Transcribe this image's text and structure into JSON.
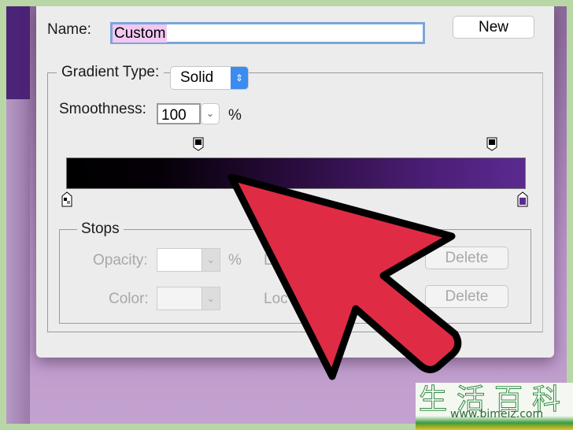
{
  "dialog": {
    "name_label": "Name:",
    "name_value": "Custom",
    "new_button": "New",
    "gradient_type_label": "Gradient Type:",
    "gradient_type_value": "Solid",
    "smoothness_label": "Smoothness:",
    "smoothness_value": "100",
    "smoothness_unit": "%",
    "stops": {
      "title": "Stops",
      "opacity_label": "Opacity:",
      "opacity_unit": "%",
      "location_label_1": "L",
      "delete_1": "Delete",
      "color_label": "Color:",
      "location_label_2": "Loc",
      "delete_2": "Delete"
    }
  },
  "gradient_colors": [
    "#000000",
    "#5b2a90"
  ],
  "watermark": {
    "chinese": "生活百科",
    "url": "www.bimeiz.com"
  },
  "arrow_color": "#e02b44"
}
